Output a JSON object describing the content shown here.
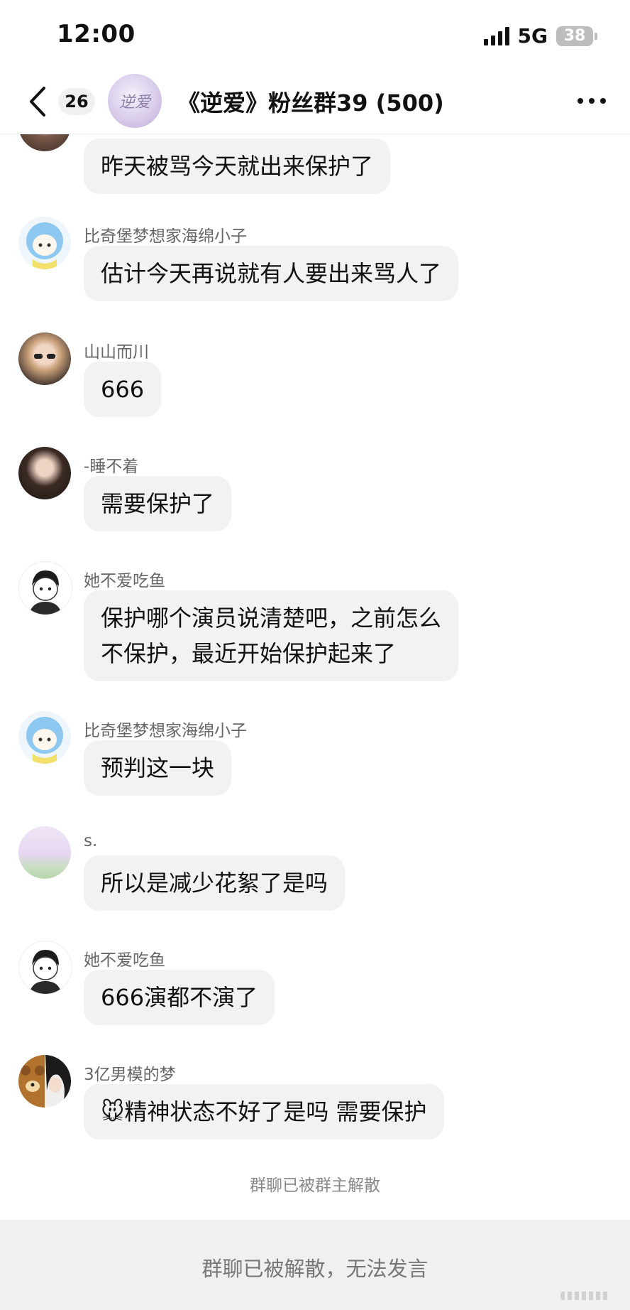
{
  "status_bar": {
    "time": "12:00",
    "network": "5G",
    "battery": "38"
  },
  "nav": {
    "unread_count": "26",
    "group_avatar_text": "逆爱",
    "title": "《逆爱》粉丝群39 (500)"
  },
  "messages": [
    {
      "sender": "",
      "text": "昨天被骂今天就出来保护了"
    },
    {
      "sender": "比奇堡梦想家海绵小子",
      "text": "估计今天再说就有人要出来骂人了"
    },
    {
      "sender": "山山而川",
      "text": "666"
    },
    {
      "sender": "-睡不着",
      "text": "需要保护了"
    },
    {
      "sender": "她不爱吃鱼",
      "text_line1": "保护哪个演员说清楚吧，之前怎么",
      "text_line2": "不保护，最近开始保护起来了"
    },
    {
      "sender": "比奇堡梦想家海绵小子",
      "text": "预判这一块"
    },
    {
      "sender": "s.",
      "text": "所以是减少花絮了是吗"
    },
    {
      "sender": "她不爱吃鱼",
      "text": "666演都不演了"
    },
    {
      "sender": "3亿男模的梦",
      "emoji": "🐭",
      "text": "精神状态不好了是吗 需要保护"
    }
  ],
  "system_notice": "群聊已被群主解散",
  "bottom_bar": {
    "text": "群聊已被解散，无法发言"
  },
  "colors": {
    "bubble": "#f2f2f2",
    "bottom_bar": "#f0f0f0",
    "meta_text": "#666666"
  }
}
